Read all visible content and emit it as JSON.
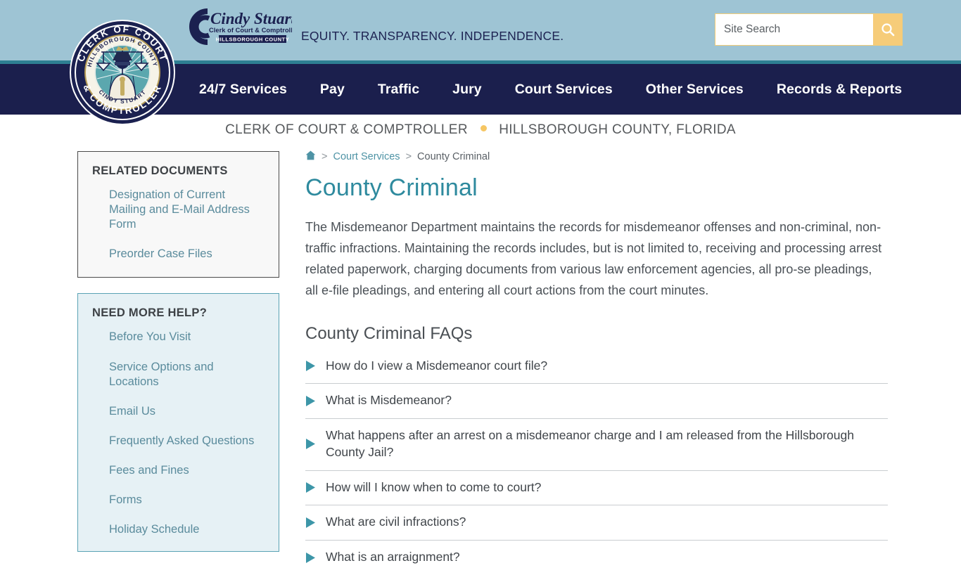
{
  "header": {
    "tagline": "EQUITY. TRANSPARENCY. INDEPENDENCE.",
    "logo": {
      "name": "Cindy Stuart",
      "subtitle": "Clerk of Court & Comptroller",
      "county": "HILLSBOROUGH COUNTY"
    },
    "seal": {
      "outer_top": "CLERK OF COURT",
      "outer_bottom": "& COMPTROLLER",
      "inner_top": "HILLSBOROUGH COUNTY",
      "inner_bottom": "CINDY STUART"
    },
    "search": {
      "placeholder": "Site Search",
      "value": "",
      "icon": "search-icon"
    }
  },
  "nav": {
    "items": [
      {
        "label": "24/7 Services"
      },
      {
        "label": "Pay"
      },
      {
        "label": "Traffic"
      },
      {
        "label": "Jury"
      },
      {
        "label": "Court Services"
      },
      {
        "label": "Other Services"
      },
      {
        "label": "Records & Reports"
      }
    ]
  },
  "subtitle": {
    "left": "CLERK OF COURT & COMPTROLLER",
    "right": "HILLSBOROUGH COUNTY, FLORIDA"
  },
  "breadcrumb": {
    "home_icon": "home-icon",
    "sep": ">",
    "items": [
      {
        "label": "Court Services",
        "current": false
      },
      {
        "label": "County Criminal",
        "current": true
      }
    ]
  },
  "main": {
    "title": "County Criminal",
    "intro": "The Misdemeanor Department maintains the records for misdemeanor offenses and non-criminal, non-traffic infractions. Maintaining the records includes, but is not limited to, receiving and processing arrest related paperwork, charging documents from various law enforcement agencies, all pro-se pleadings, all e-file pleadings, and entering all court actions from the court minutes.",
    "faq_title": "County Criminal FAQs",
    "faqs": [
      {
        "question": "How do I view a Misdemeanor court file?"
      },
      {
        "question": "What is Misdemeanor?"
      },
      {
        "question": "What happens after an arrest on a misdemeanor charge and I am released from the Hillsborough County Jail?"
      },
      {
        "question": "How will I know when to come to court?"
      },
      {
        "question": "What are civil infractions?"
      },
      {
        "question": "What is an arraignment?"
      }
    ]
  },
  "sidebar": {
    "related_documents": {
      "title": "RELATED DOCUMENTS",
      "links": [
        {
          "label": "Designation of Current Mailing and E-Mail Address Form"
        },
        {
          "label": "Preorder Case Files"
        }
      ]
    },
    "need_more_help": {
      "title": "NEED MORE HELP?",
      "links": [
        {
          "label": "Before You Visit"
        },
        {
          "label": "Service Options and Locations"
        },
        {
          "label": "Email Us"
        },
        {
          "label": "Frequently Asked Questions"
        },
        {
          "label": "Fees and Fines"
        },
        {
          "label": "Forms"
        },
        {
          "label": "Holiday Schedule"
        }
      ]
    }
  },
  "colors": {
    "header_blue": "#9ec4d4",
    "teal_stripe": "#2e7f92",
    "nav_navy": "#1b1f4d",
    "accent_teal": "#2e8a9e",
    "link_teal": "#5a8b9c",
    "search_gold": "#f6cc79",
    "dot_gold": "#f6c663",
    "help_card_bg": "#e6f1f5",
    "help_card_border": "#5aa3b4",
    "docs_card_bg": "#f8f8f8",
    "docs_card_border": "#4a4a4a"
  }
}
